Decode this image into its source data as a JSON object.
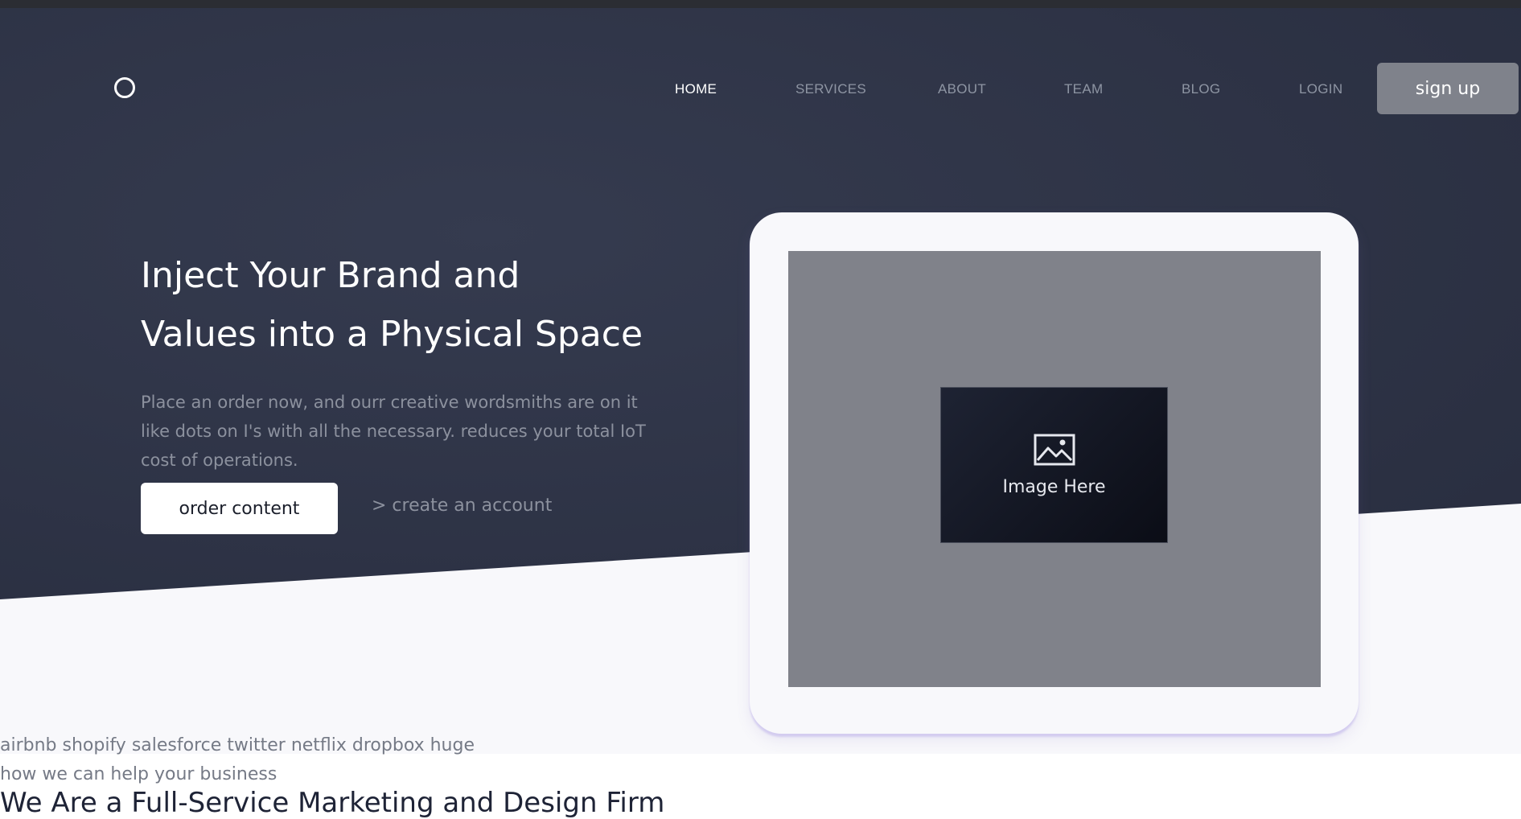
{
  "nav": {
    "items": [
      {
        "label": "HOME",
        "active": true
      },
      {
        "label": "SERVICES",
        "active": false
      },
      {
        "label": "ABOUT",
        "active": false
      },
      {
        "label": "TEAM",
        "active": false
      },
      {
        "label": "BLOG",
        "active": false
      },
      {
        "label": "LOGIN",
        "active": false
      }
    ],
    "signup_label": "sign up"
  },
  "logo": {
    "icon": "circle-logo-icon"
  },
  "hero": {
    "headline_line1": "Inject Your Brand and",
    "headline_line2": "Values into a Physical Space",
    "subtext_line1": "Place an order now, and ourr creative wordsmiths are on it",
    "subtext_line2": "like dots on I's with all the necessary. reduces your total IoT",
    "subtext_line3": "cost of operations.",
    "order_button": "order content",
    "create_link": "> create an account",
    "image_label": "Image Here",
    "image_icon": "image-icon"
  },
  "brands": {
    "text": "airbnb shopify salesforce twitter netflix dropbox huge"
  },
  "services": {
    "eyebrow": "how we can help your business",
    "title": "We Are a Full-Service Marketing and Design Firm"
  },
  "colors": {
    "hero_bg": "#2c3245",
    "light_bg": "#f8f8fb",
    "signup_bg": "#7f828b",
    "image_bg": "#80828a",
    "placeholder_bg": "#12151f"
  }
}
